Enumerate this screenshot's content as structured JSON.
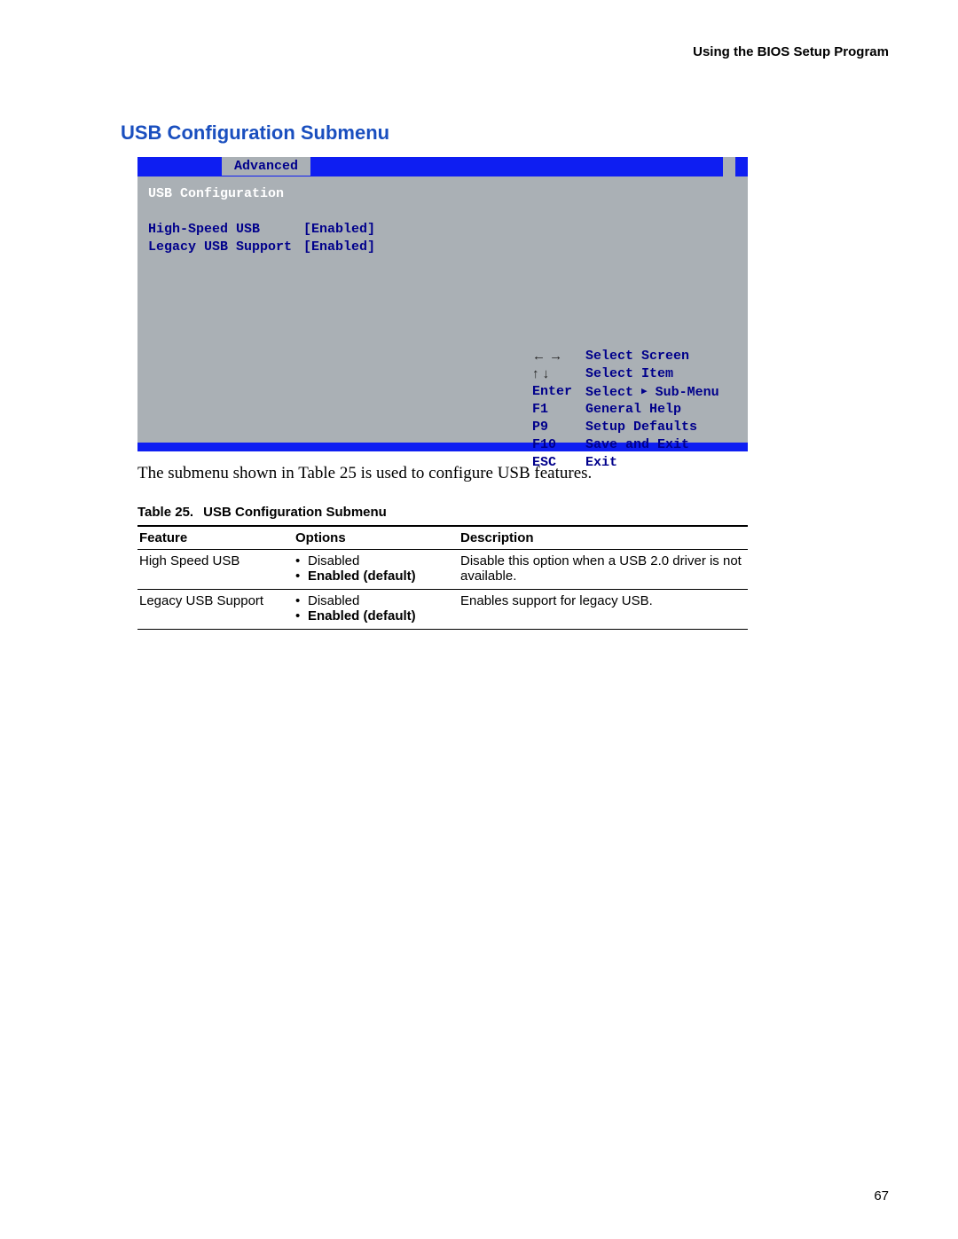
{
  "header": {
    "running": "Using the BIOS Setup Program"
  },
  "section": {
    "heading": "USB Configuration Submenu"
  },
  "bios": {
    "tab": "Advanced",
    "title": "USB Configuration",
    "items": [
      {
        "label": "High-Speed USB",
        "value": "[Enabled]"
      },
      {
        "label": "Legacy USB Support",
        "value": "[Enabled]"
      }
    ],
    "legend": [
      {
        "key": "← →",
        "desc": "Select Screen",
        "dark": false
      },
      {
        "key": "↑ ↓",
        "desc": "Select Item",
        "dark": false
      },
      {
        "key": "Enter",
        "desc": "Select ▸ Sub-Menu",
        "dark": true
      },
      {
        "key": "F1",
        "desc": "General Help",
        "dark": true
      },
      {
        "key": "P9",
        "desc": "Setup Defaults",
        "dark": true
      },
      {
        "key": "F10",
        "desc": "Save and Exit",
        "dark": true
      },
      {
        "key": "ESC",
        "desc": "Exit",
        "dark": true
      }
    ]
  },
  "caption_text": "The submenu shown in Table 25 is used to configure USB features.",
  "table_caption": {
    "number": "Table 25.",
    "title": "USB Configuration Submenu"
  },
  "table": {
    "headers": {
      "feature": "Feature",
      "options": "Options",
      "description": "Description"
    },
    "rows": [
      {
        "feature": "High Speed USB",
        "opt1": "Disabled",
        "opt2": "Enabled (default)",
        "description": "Disable this option when a USB 2.0 driver is not available."
      },
      {
        "feature": "Legacy USB Support",
        "opt1": "Disabled",
        "opt2": "Enabled (default)",
        "description": "Enables support for legacy USB."
      }
    ]
  },
  "page_number": "67"
}
